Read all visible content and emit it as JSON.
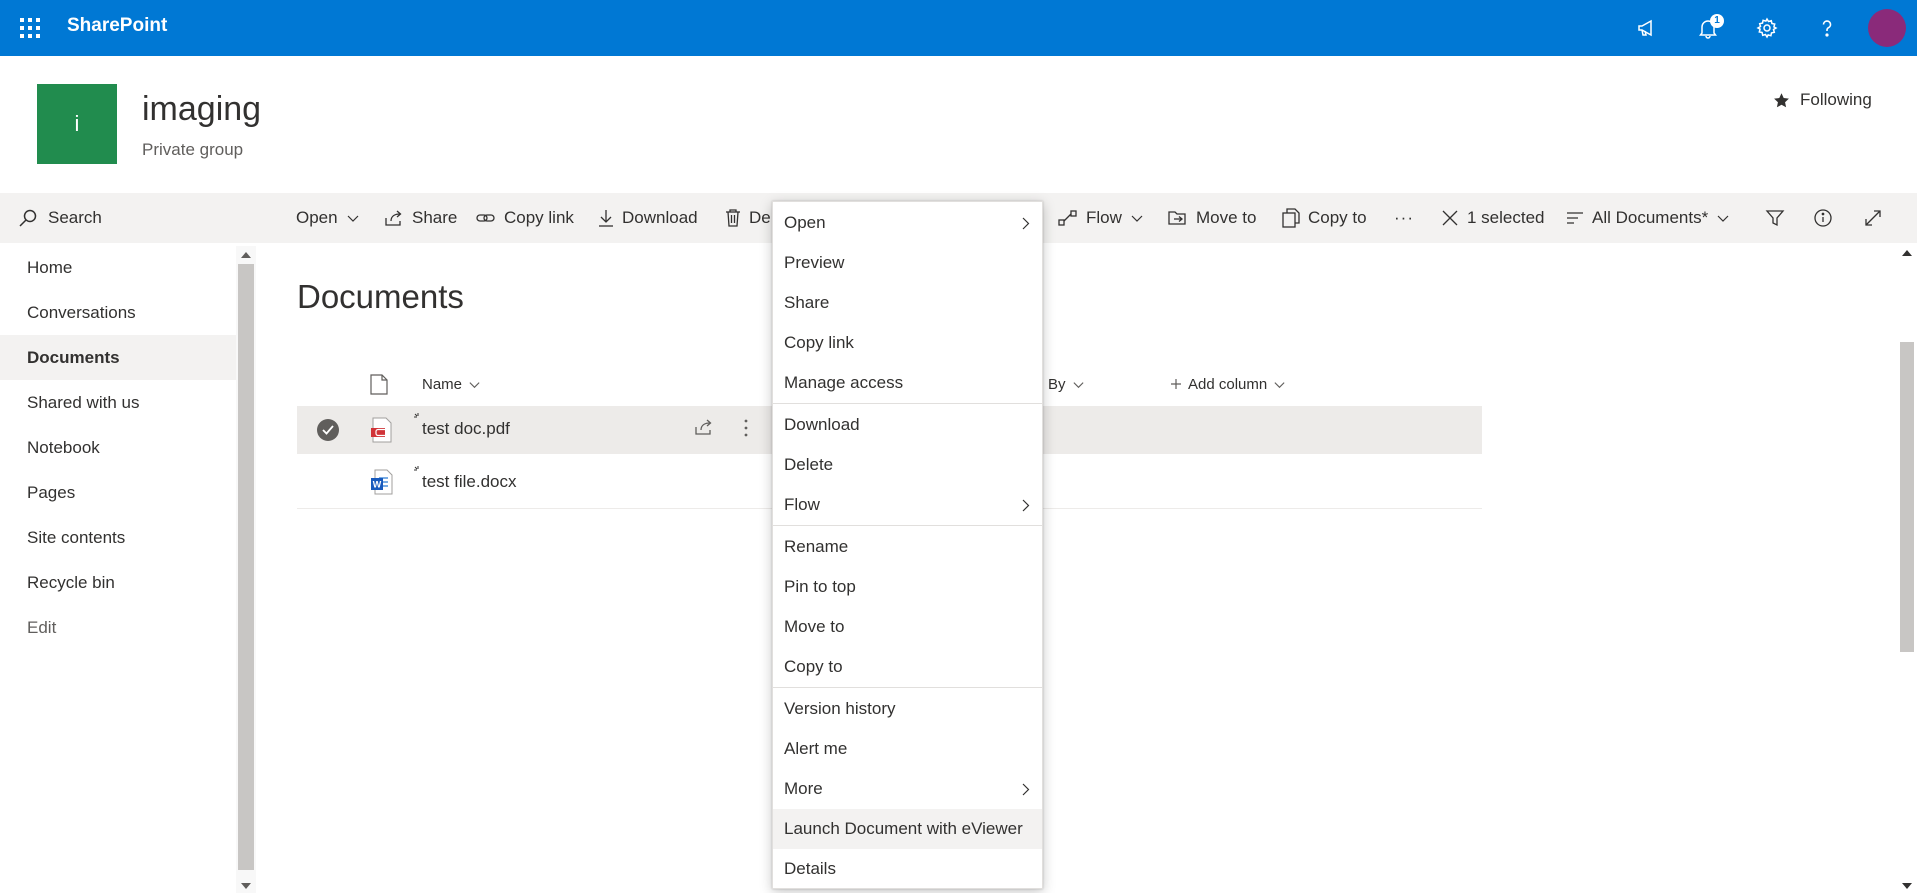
{
  "suitebar": {
    "brand": "SharePoint",
    "notification_count": "1",
    "colors": {
      "bar": "#0078d4",
      "avatar": "#8a2a7a"
    }
  },
  "site": {
    "logo_letter": "i",
    "title": "imaging",
    "subtitle": "Private group",
    "following_label": "Following",
    "logo_color": "#218c4e"
  },
  "leftnav": {
    "search_placeholder": "Search",
    "items": [
      {
        "label": "Home"
      },
      {
        "label": "Conversations"
      },
      {
        "label": "Documents",
        "active": true
      },
      {
        "label": "Shared with us"
      },
      {
        "label": "Notebook"
      },
      {
        "label": "Pages"
      },
      {
        "label": "Site contents"
      },
      {
        "label": "Recycle bin"
      }
    ],
    "edit_label": "Edit"
  },
  "commandbar": {
    "open": "Open",
    "share": "Share",
    "copy_link": "Copy link",
    "download": "Download",
    "delete_partial": "De",
    "flow": "Flow",
    "move_to": "Move to",
    "copy_to": "Copy to",
    "more": "···",
    "selected": "1 selected",
    "view": "All Documents*"
  },
  "library": {
    "title": "Documents",
    "columns": {
      "name": "Name",
      "modified_by_partial": "By",
      "add_column": "Add column"
    },
    "files": [
      {
        "name": "test doc.pdf",
        "type": "pdf",
        "selected": true
      },
      {
        "name": "test file.docx",
        "type": "docx",
        "selected": false
      }
    ]
  },
  "context_menu": {
    "items": [
      {
        "label": "Open",
        "submenu": true
      },
      {
        "label": "Preview"
      },
      {
        "label": "Share"
      },
      {
        "label": "Copy link"
      },
      {
        "label": "Manage access"
      },
      {
        "label": "Download"
      },
      {
        "label": "Delete"
      },
      {
        "label": "Flow",
        "submenu": true
      },
      {
        "label": "Rename"
      },
      {
        "label": "Pin to top"
      },
      {
        "label": "Move to"
      },
      {
        "label": "Copy to"
      },
      {
        "label": "Version history"
      },
      {
        "label": "Alert me"
      },
      {
        "label": "More",
        "submenu": true
      },
      {
        "label": "Launch Document with eViewer",
        "hover": true
      },
      {
        "label": "Details"
      }
    ]
  }
}
